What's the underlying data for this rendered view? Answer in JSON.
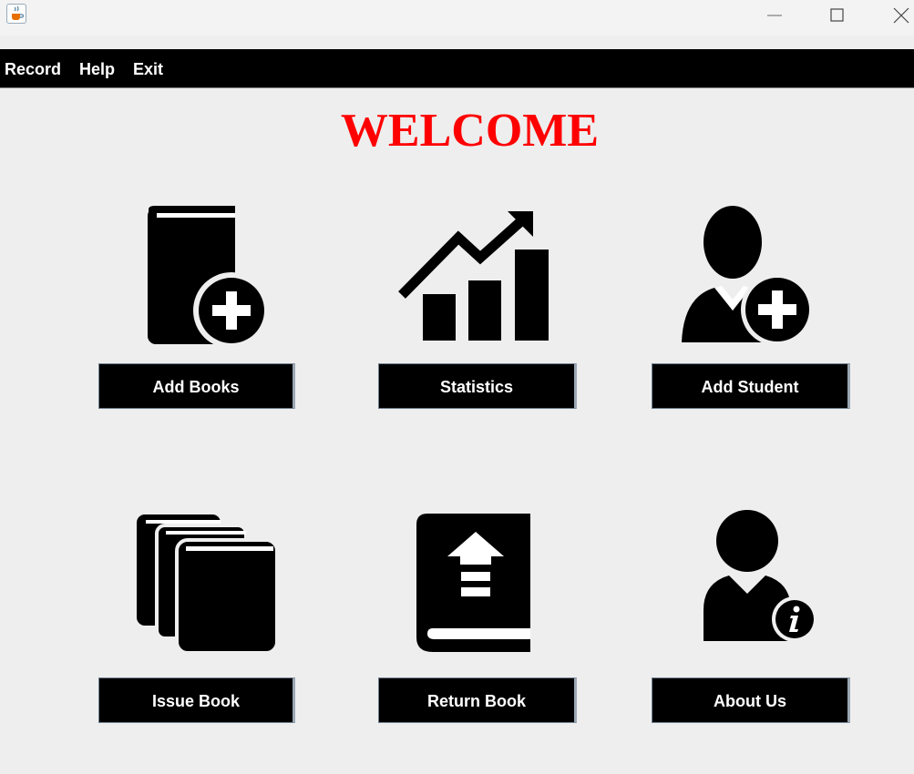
{
  "window": {
    "app_icon": "java-cup-icon",
    "controls": [
      "minimize-icon",
      "maximize-icon",
      "close-icon"
    ]
  },
  "menu": {
    "record": "Record",
    "help": "Help",
    "exit": "Exit"
  },
  "main": {
    "title": "WELCOME",
    "title_color": "#ff0000",
    "buttons": {
      "add_books": "Add Books",
      "statistics": "Statistics",
      "add_student": "Add Student",
      "issue_book": "Issue Book",
      "return_book": "Return Book",
      "about_us": "About Us"
    },
    "icons": [
      "book-plus-icon",
      "chart-trend-icon",
      "user-plus-icon",
      "books-stack-icon",
      "book-upload-icon",
      "user-info-icon"
    ]
  }
}
